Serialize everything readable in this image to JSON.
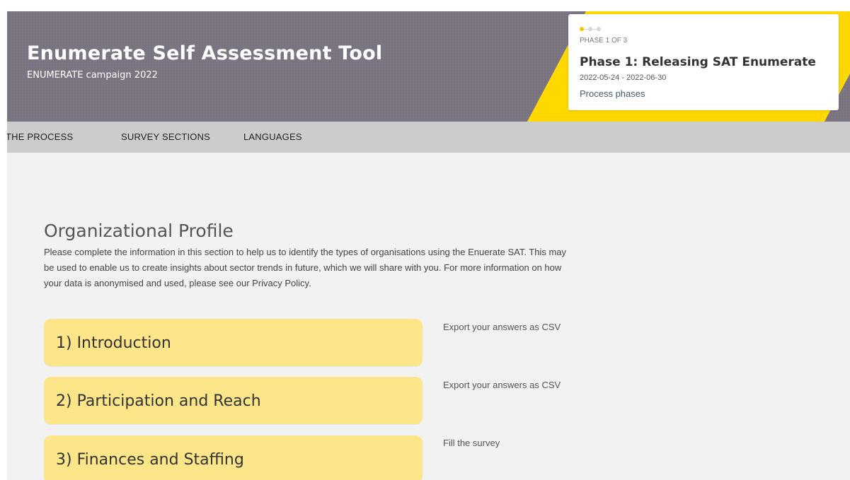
{
  "header": {
    "title": "Enumerate Self Assessment Tool",
    "subtitle": "ENUMERATE campaign 2022",
    "header_color": "#7a7380",
    "accent_color": "#ffd800"
  },
  "phase_card": {
    "counter": "PHASE 1 OF 3",
    "title": "Phase 1: Releasing SAT Enumerate",
    "dates": "2022-05-24 - 2022-06-30",
    "link": "Process phases",
    "current_phase": 1,
    "total_phases": 3
  },
  "nav": {
    "items": [
      "THE PROCESS",
      "SURVEY SECTIONS",
      "LANGUAGES"
    ]
  },
  "section": {
    "title": "Organizational Profile",
    "description": "Please complete the information in this section to help us to identify the types of organisations using the Enuerate SAT. This may be used to enable us to create insights about sector trends in future, which we will share with you. For more information on how your data is anonymised and used, please see our Privacy Policy."
  },
  "survey_sections": [
    {
      "label": "1) Introduction",
      "action": "Export your answers as CSV"
    },
    {
      "label": "2) Participation and Reach",
      "action": "Export your answers as CSV"
    },
    {
      "label": "3) Finances and Staffing",
      "action": "Fill the survey"
    }
  ]
}
